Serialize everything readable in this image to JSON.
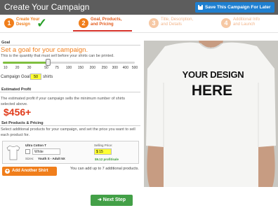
{
  "header": {
    "title": "Create Your Campaign",
    "save_label": "Save This Campaign For Later"
  },
  "steps": [
    {
      "number": "1",
      "label_line1": "Create Your",
      "label_line2": "Design",
      "state": "complete"
    },
    {
      "number": "2",
      "label_line1": "Goal, Products,",
      "label_line2": "and Pricing",
      "state": "active"
    },
    {
      "number": "3",
      "label_line1": "Title, Description,",
      "label_line2": "and Details",
      "state": "upcoming"
    },
    {
      "number": "4",
      "label_line1": "Additional Info",
      "label_line2": "and Launch",
      "state": "upcoming"
    }
  ],
  "goal": {
    "section_label": "Goal",
    "title": "Set a goal for your campaign.",
    "description": "This is the quantity that must sell before your shirts can be printed.",
    "ticks": [
      "10",
      "20",
      "30",
      "50",
      "75",
      "100",
      "150",
      "200",
      "250",
      "300",
      "400",
      "500"
    ],
    "selected_value": "50",
    "campaign_goal_label": "Campaign Goal:",
    "campaign_goal_value": "50",
    "unit": "shirts"
  },
  "estimated_profit": {
    "section_label": "Estimated Profit",
    "description": "The estimated profit if your campaign sells the minimum number of shirts selected above.",
    "value": "$456+"
  },
  "products": {
    "section_label": "Set Products & Pricing",
    "description": "Select additional products for your campaign, and set the price you want to sell each product for.",
    "items": [
      {
        "name": "Ultra Cotton T",
        "color": "White",
        "sizes_label": "Sizes:",
        "sizes_value": "Youth S - Adult 5X",
        "selling_price_label": "Selling Price:",
        "selling_price": "$ 15",
        "profit": "$9.12 profit/sale"
      }
    ],
    "add_button": "Add Another Shirt",
    "add_note": "You can add up to 7 additional products."
  },
  "design": {
    "line1": "YOUR DESIGN",
    "line2": "HERE"
  },
  "footer": {
    "next_label": "Next Step"
  },
  "colors": {
    "accent_orange": "#f07e1b",
    "active_red": "#d6332b",
    "save_blue": "#1f7fd0",
    "next_green": "#43a047",
    "highlight_yellow": "#ffff33",
    "profit_red": "#e03a1a"
  }
}
